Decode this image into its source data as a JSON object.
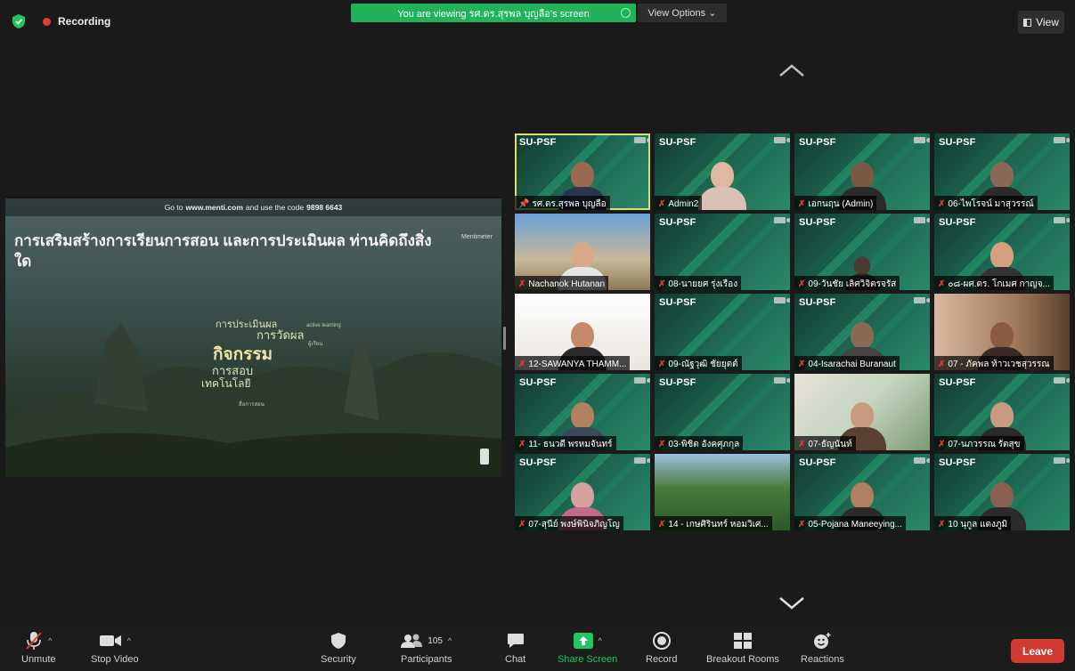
{
  "status": {
    "recording_label": "Recording",
    "viewing_banner": "You are viewing รศ.ดร.สุรพล บุญลือ's screen",
    "view_options_label": "View Options ⌄",
    "view_button_label": "View"
  },
  "shared_screen": {
    "code_bar_prefix": "Go to",
    "code_bar_site": "www.menti.com",
    "code_bar_middle": "and use the code",
    "code_bar_code": "9898 6643",
    "question": "การเสริมสร้างการเรียนการสอน และการประเมินผล ท่านคิดถึงสิ่งใด",
    "brand": "Mentimeter",
    "cloud_words": {
      "w1": "กิจกรรม",
      "w2": "การวัดผล",
      "w3": "การสอบ",
      "w4": "เทคโนโลยี",
      "w5": "การประเมินผล",
      "w6": "ผู้เรียน",
      "w7": "สื่อการสอน",
      "w8": "active learning"
    }
  },
  "gallery": {
    "brand_label": "SU-PSF",
    "tiles": [
      {
        "name": "รศ.ดร.สุรพล บุญลือ"
      },
      {
        "name": "Admin2"
      },
      {
        "name": "เอกนฤน (Admin)"
      },
      {
        "name": "06-ไพโรจน์ มาสุวรรณ์"
      },
      {
        "name": "Nachanok Hutanan"
      },
      {
        "name": "08-นายยศ รุ่งเรือง"
      },
      {
        "name": "09-วันชัย เลิศวิจิตรจรัส"
      },
      {
        "name": "๐๘-ผศ.ดร. โกเมศ กาญจ..."
      },
      {
        "name": "12-SAWANYA THAMM..."
      },
      {
        "name": "09-ณัฐวุฒิ ชัยยุตต์"
      },
      {
        "name": "04-Isarachai Buranaut"
      },
      {
        "name": "07 - ภัคพล ท้าวเวชสุวรรณ"
      },
      {
        "name": "11- ธนวดี พรหมจันทร์"
      },
      {
        "name": "03-พิชิต อังคศุภกุล"
      },
      {
        "name": "07-ธัญนันท์"
      },
      {
        "name": "07-นภวรรณ รัตสุข"
      },
      {
        "name": "07-สุนีย์ พงษ์พินิจภิญโญ"
      },
      {
        "name": "14 - เกษศิรินทร์ หอมวิเศ..."
      },
      {
        "name": "05-Pojana Maneeying..."
      },
      {
        "name": "10 นุกูล แดงภูมิ"
      }
    ]
  },
  "toolbar": {
    "unmute": "Unmute",
    "stop_video": "Stop Video",
    "security": "Security",
    "participants": "Participants",
    "participants_count": "105",
    "chat": "Chat",
    "share_screen": "Share Screen",
    "record": "Record",
    "breakout_rooms": "Breakout Rooms",
    "reactions": "Reactions",
    "leave": "Leave"
  },
  "colors": {
    "recording_dot": "#e53935",
    "viewing_banner_bg": "#21b35a",
    "share_screen_accent": "#22c55e",
    "leave_button": "#d13a32",
    "active_speaker_border": "#d9df6b",
    "tile_teal": "#1e6a55"
  }
}
